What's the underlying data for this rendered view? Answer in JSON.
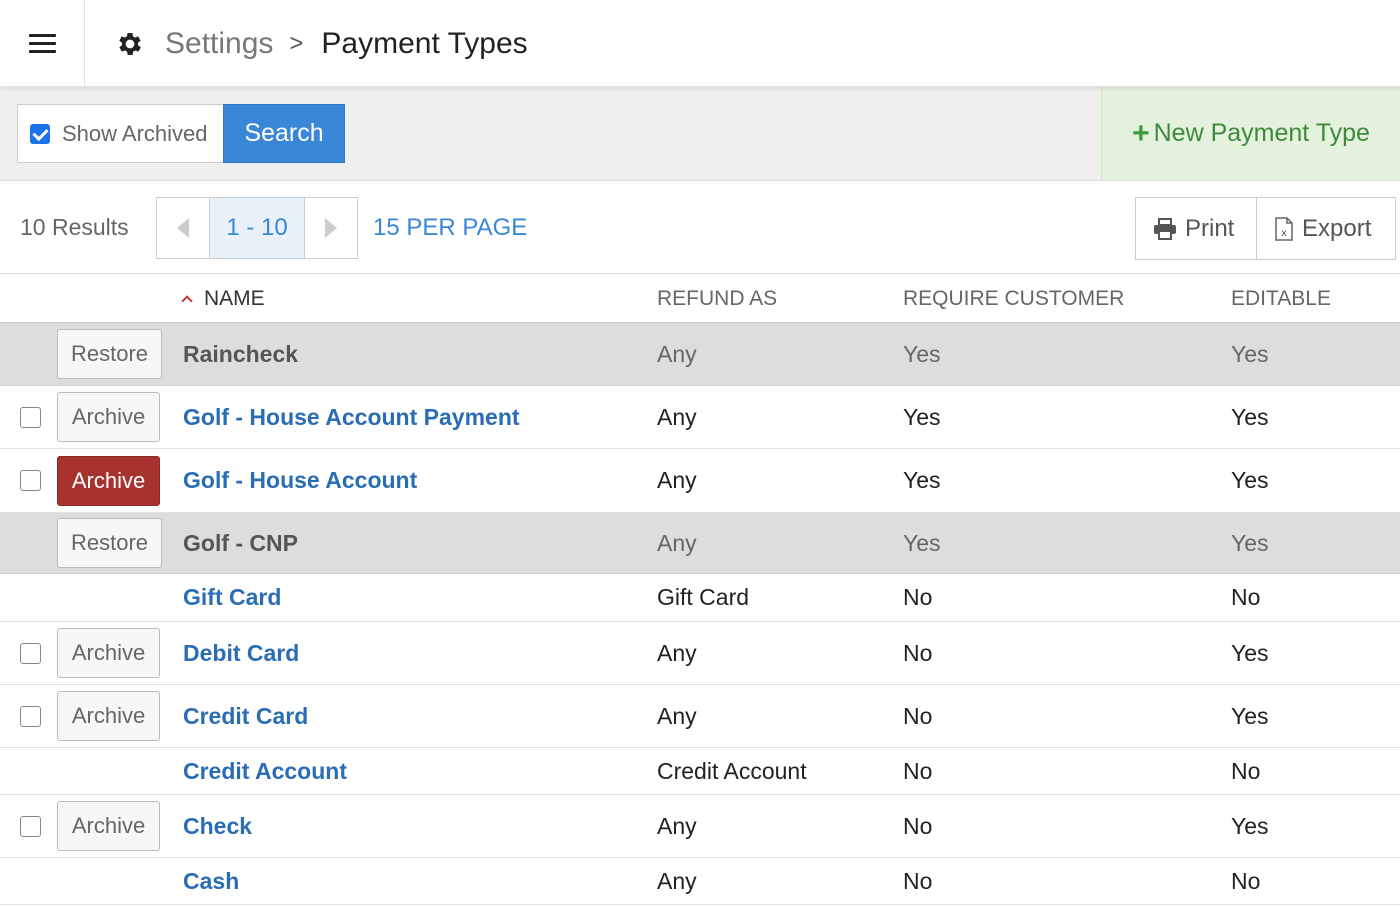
{
  "header": {
    "menu_icon": "hamburger-icon",
    "settings_icon": "gear-icon",
    "breadcrumb_root": "Settings",
    "breadcrumb_separator": ">",
    "breadcrumb_current": "Payment Types"
  },
  "toolbar": {
    "show_archived_label": "Show Archived",
    "show_archived_checked": true,
    "search_label": "Search",
    "new_label": "New Payment Type",
    "new_icon": "plus-icon",
    "accent_color": "#3a87d8",
    "new_color": "#3c8a3c"
  },
  "results": {
    "count_label": "10 Results",
    "page_range": "1 - 10",
    "per_page_label": "15 PER PAGE",
    "print_label": "Print",
    "export_label": "Export"
  },
  "table": {
    "columns": {
      "name": "NAME",
      "refund_as": "REFUND AS",
      "require_customer": "REQUIRE CUSTOMER",
      "editable": "EDITABLE"
    },
    "rows": [
      {
        "name": "Raincheck",
        "refund_as": "Any",
        "require_customer": "Yes",
        "editable": "Yes",
        "archived": true,
        "action": "Restore",
        "checkbox": false,
        "danger": false
      },
      {
        "name": "Golf - House Account Payment",
        "refund_as": "Any",
        "require_customer": "Yes",
        "editable": "Yes",
        "archived": false,
        "action": "Archive",
        "checkbox": true,
        "danger": false
      },
      {
        "name": "Golf - House Account",
        "refund_as": "Any",
        "require_customer": "Yes",
        "editable": "Yes",
        "archived": false,
        "action": "Archive",
        "checkbox": true,
        "danger": true
      },
      {
        "name": "Golf - CNP",
        "refund_as": "Any",
        "require_customer": "Yes",
        "editable": "Yes",
        "archived": true,
        "action": "Restore",
        "checkbox": false,
        "danger": false
      },
      {
        "name": "Gift Card",
        "refund_as": "Gift Card",
        "require_customer": "No",
        "editable": "No",
        "archived": false,
        "action": "",
        "checkbox": false,
        "danger": false
      },
      {
        "name": "Debit Card",
        "refund_as": "Any",
        "require_customer": "No",
        "editable": "Yes",
        "archived": false,
        "action": "Archive",
        "checkbox": true,
        "danger": false
      },
      {
        "name": "Credit Card",
        "refund_as": "Any",
        "require_customer": "No",
        "editable": "Yes",
        "archived": false,
        "action": "Archive",
        "checkbox": true,
        "danger": false
      },
      {
        "name": "Credit Account",
        "refund_as": "Credit Account",
        "require_customer": "No",
        "editable": "No",
        "archived": false,
        "action": "",
        "checkbox": false,
        "danger": false
      },
      {
        "name": "Check",
        "refund_as": "Any",
        "require_customer": "No",
        "editable": "Yes",
        "archived": false,
        "action": "Archive",
        "checkbox": true,
        "danger": false
      },
      {
        "name": "Cash",
        "refund_as": "Any",
        "require_customer": "No",
        "editable": "No",
        "archived": false,
        "action": "",
        "checkbox": false,
        "danger": false
      }
    ]
  }
}
